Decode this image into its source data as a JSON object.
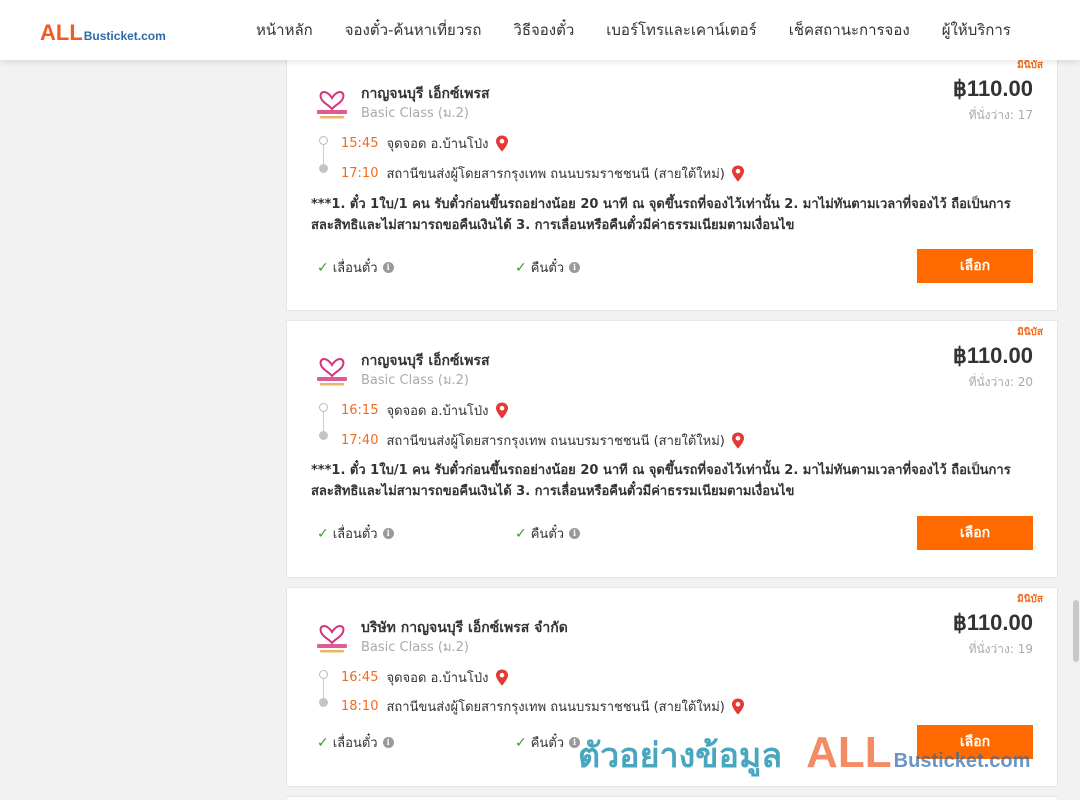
{
  "header": {
    "logo": {
      "prefix": "ALL",
      "suffix": "Busticket.com"
    },
    "nav": [
      {
        "label": "หน้าหลัก"
      },
      {
        "label": "จองตั๋ว-ค้นหาเที่ยวรถ"
      },
      {
        "label": "วิธีจองตั๋ว"
      },
      {
        "label": "เบอร์โทรและเคาน์เตอร์"
      },
      {
        "label": "เช็คสถานะการจอง"
      },
      {
        "label": "ผู้ให้บริการ"
      }
    ]
  },
  "colors": {
    "accent": "#ff6a00",
    "time": "#f26b1d",
    "check": "#3a9b2f",
    "pin": "#e53935"
  },
  "trips": [
    {
      "promo": "มินิบัส",
      "operator": "กาญจนบุรี เอ็กซ์เพรส",
      "bus_class": "Basic Class (ม.2)",
      "price": "฿110.00",
      "seats": "ที่นั่งว่าง: 17",
      "depart_time": "15:45",
      "depart_place": "จุดจอด อ.บ้านโป่ง",
      "arrive_time": "17:10",
      "arrive_place": "สถานีขนส่งผู้โดยสารกรุงเทพ ถนนบรมราชชนนี (สายใต้ใหม่)",
      "note": "***1. ตั๋ว 1ใบ/1 คน รับตั๋วก่อนขึ้นรถอย่างน้อย 20 นาที ณ จุดขึ้นรถที่จองไว้เท่านั้น 2. มาไม่ทันตามเวลาที่จองไว้ ถือเป็นการสละสิทธิและไม่สามารถขอคืนเงินได้ 3. การเลื่อนหรือคืนตั๋วมีค่าธรรมเนียมตามเงื่อนไข",
      "feature_change": "เลื่อนตั๋ว",
      "feature_refund": "คืนตั๋ว",
      "select_label": "เลือก"
    },
    {
      "promo": "มินิบัส",
      "operator": "กาญจนบุรี เอ็กซ์เพรส",
      "bus_class": "Basic Class (ม.2)",
      "price": "฿110.00",
      "seats": "ที่นั่งว่าง: 20",
      "depart_time": "16:15",
      "depart_place": "จุดจอด อ.บ้านโป่ง",
      "arrive_time": "17:40",
      "arrive_place": "สถานีขนส่งผู้โดยสารกรุงเทพ ถนนบรมราชชนนี (สายใต้ใหม่)",
      "note": "***1. ตั๋ว 1ใบ/1 คน รับตั๋วก่อนขึ้นรถอย่างน้อย 20 นาที ณ จุดขึ้นรถที่จองไว้เท่านั้น 2. มาไม่ทันตามเวลาที่จองไว้ ถือเป็นการสละสิทธิและไม่สามารถขอคืนเงินได้ 3. การเลื่อนหรือคืนตั๋วมีค่าธรรมเนียมตามเงื่อนไข",
      "feature_change": "เลื่อนตั๋ว",
      "feature_refund": "คืนตั๋ว",
      "select_label": "เลือก"
    },
    {
      "promo": "มินิบัส",
      "operator": "บริษัท กาญจนบุรี เอ็กซ์เพรส จำกัด",
      "bus_class": "Basic Class (ม.2)",
      "price": "฿110.00",
      "seats": "ที่นั่งว่าง: 19",
      "depart_time": "16:45",
      "depart_place": "จุดจอด อ.บ้านโป่ง",
      "arrive_time": "18:10",
      "arrive_place": "สถานีขนส่งผู้โดยสารกรุงเทพ ถนนบรมราชชนนี (สายใต้ใหม่)",
      "note": "",
      "feature_change": "เลื่อนตั๋ว",
      "feature_refund": "คืนตั๋ว",
      "select_label": "เลือก"
    }
  ],
  "watermark": {
    "text": "ตัวอย่างข้อมูล",
    "prefix": "ALL",
    "suffix": "Busticket.com"
  }
}
